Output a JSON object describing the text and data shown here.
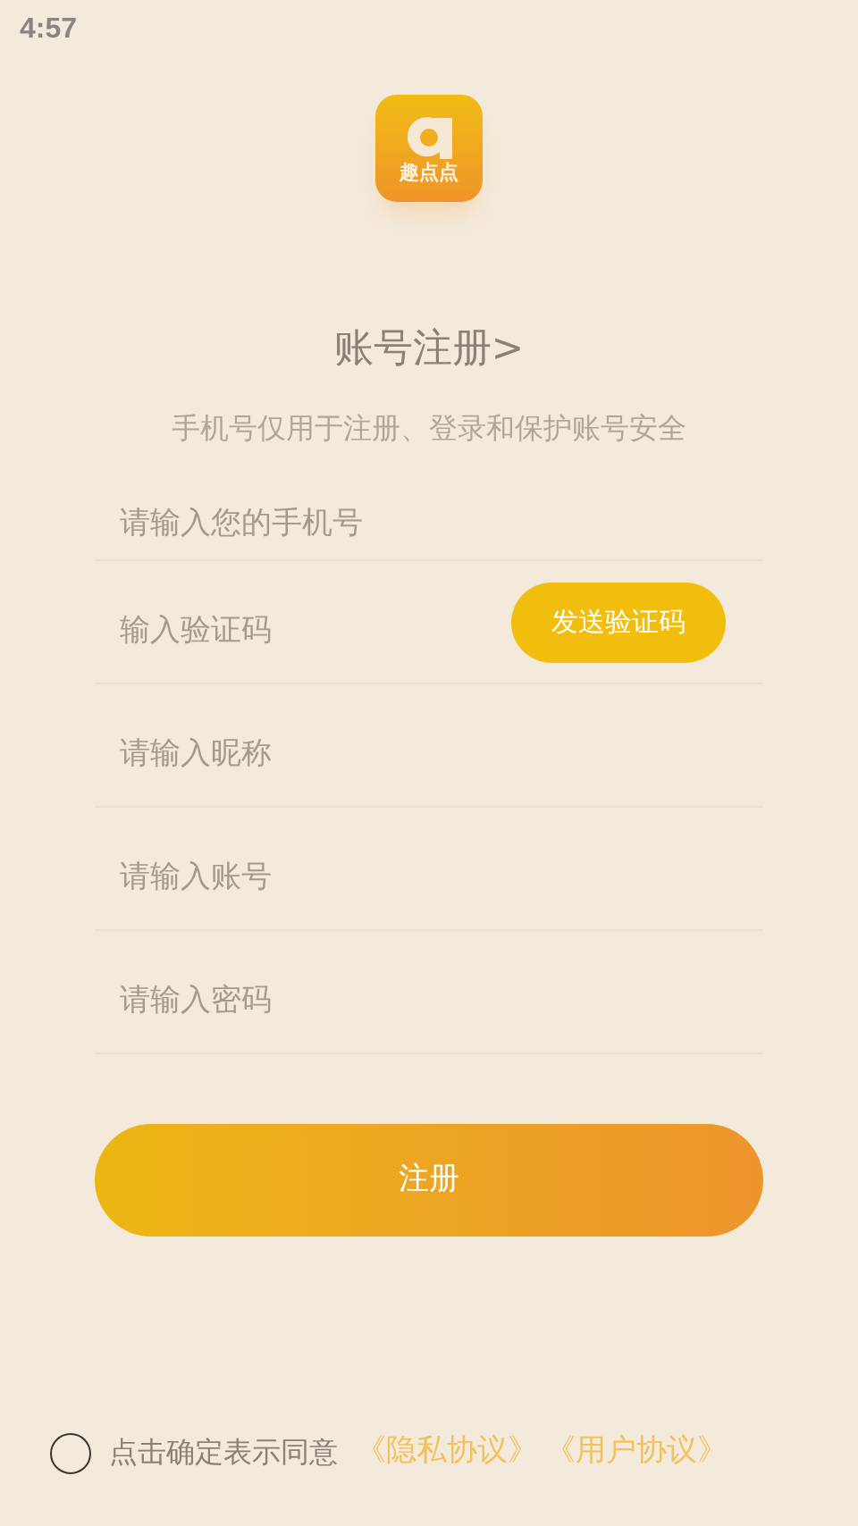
{
  "status_bar": {
    "time": "4:57"
  },
  "logo": {
    "label": "趣点点"
  },
  "title": "账号注册>",
  "subtitle": "手机号仅用于注册、登录和保护账号安全",
  "fields": [
    {
      "kind": "text",
      "placeholder": "请输入您的手机号"
    },
    {
      "kind": "code",
      "placeholder": "输入验证码",
      "button": "发送验证码"
    },
    {
      "kind": "text",
      "placeholder": "请输入昵称"
    },
    {
      "kind": "text",
      "placeholder": "请输入账号"
    },
    {
      "kind": "password",
      "placeholder": "请输入密码"
    }
  ],
  "submit": "注册",
  "agreement": {
    "checked": false,
    "text": "点击确定表示同意",
    "links": [
      "《隐私协议》",
      "《用户协议》"
    ]
  }
}
